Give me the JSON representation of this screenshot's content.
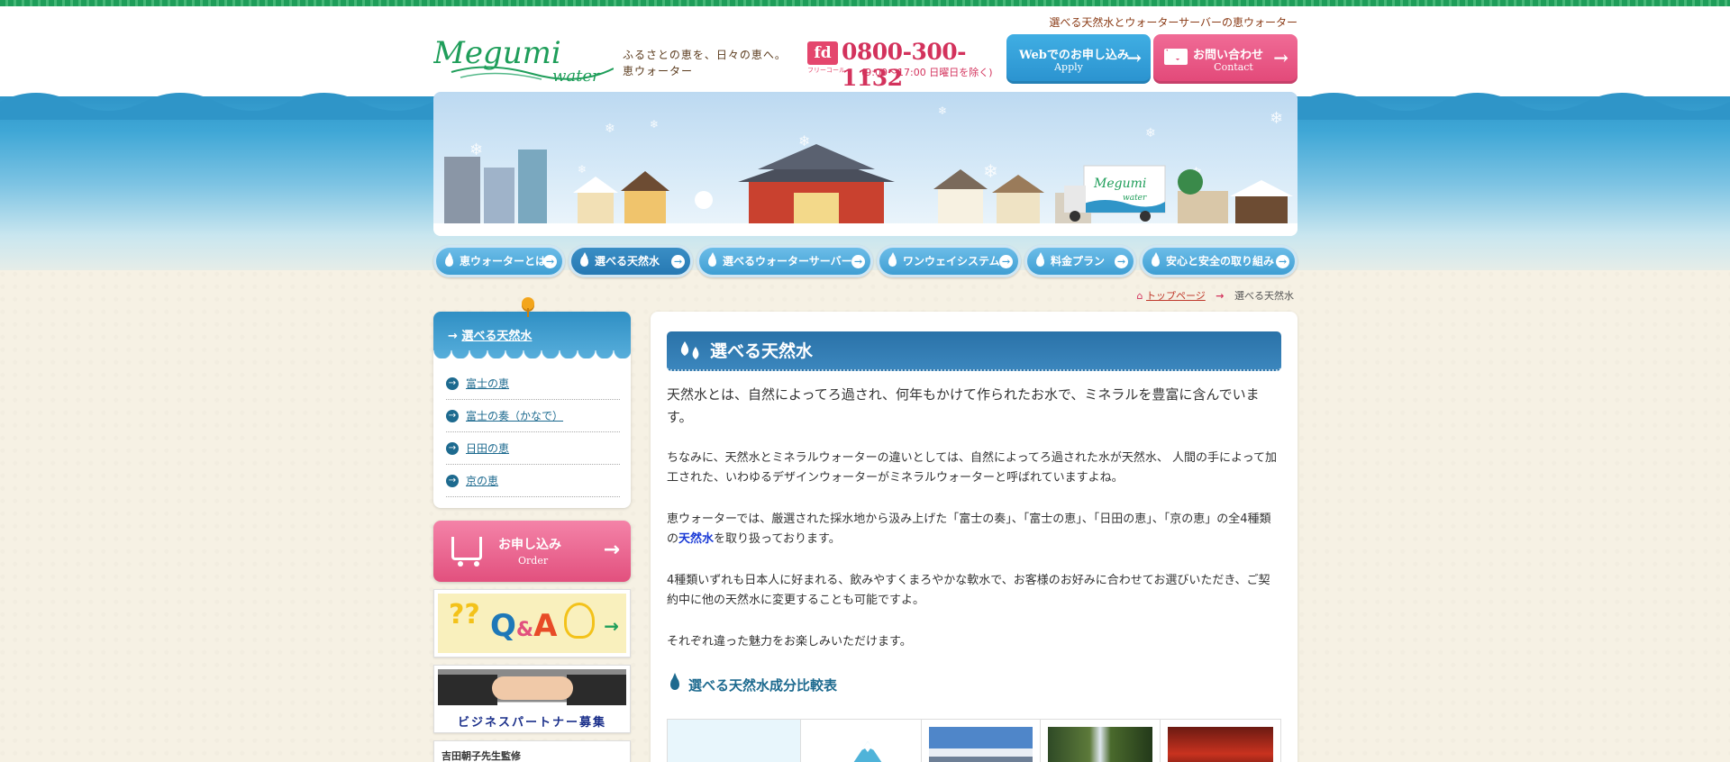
{
  "header": {
    "tagline": "選べる天然水とウォーターサーバーの恵ウォーター",
    "logo_main": "Megumi",
    "logo_sub": "water",
    "slogan_line1": "ふるさとの恵を、日々の恵へ。",
    "slogan_line2": "恵ウォーター",
    "freedial_mark": "fd",
    "freedial_label": "フリーコール",
    "phone": "0800-300-1132",
    "hours": "(9:00～17:00 日曜日を除く)",
    "apply_button": {
      "label": "Webでのお申し込み",
      "sub": "Apply"
    },
    "contact_button": {
      "label": "お問い合わせ",
      "sub": "Contact"
    }
  },
  "hero": {
    "truck_brand": "Megumi",
    "truck_sub": "water"
  },
  "nav": [
    {
      "label": "恵ウォーターとは",
      "active": false
    },
    {
      "label": "選べる天然水",
      "active": true
    },
    {
      "label": "選べるウォーターサーバー",
      "active": false
    },
    {
      "label": "ワンウェイシステム",
      "active": false
    },
    {
      "label": "料金プラン",
      "active": false
    },
    {
      "label": "安心と安全の取り組み",
      "active": false
    }
  ],
  "breadcrumb": {
    "home": "トップページ",
    "current": "選べる天然水"
  },
  "sidebar": {
    "title": "選べる天然水",
    "items": [
      {
        "label": "富士の恵"
      },
      {
        "label": "富士の奏（かなで）"
      },
      {
        "label": "日田の恵"
      },
      {
        "label": "京の恵"
      }
    ],
    "order": {
      "label": "お申し込み",
      "sub": "Order"
    },
    "qa_banner": {
      "q": "Q",
      "amp": "&",
      "a": "A",
      "question_marks": "??"
    },
    "business_banner": "ビジネスパートナー募集",
    "supervisor_banner": "吉田朝子先生監修"
  },
  "main": {
    "title": "選べる天然水",
    "lead": "天然水とは、自然によってろ過され、何年もかけて作られたお水で、ミネラルを豊富に含んでいます。",
    "p1": "ちなみに、天然水とミネラルウォーターの違いとしては、自然によってろ過された水が天然水、 人間の手によって加工された、いわゆるデザインウォーターがミネラルウォーターと呼ばれていますよね。",
    "p2_before": "恵ウォーターでは、厳選された採水地から汲み上げた「富士の奏」、「富士の恵」、「日田の恵」、「京の恵」の全4種類の",
    "p2_highlight": "天然水",
    "p2_after": "を取り扱っております。",
    "p3": "4種類いずれも日本人に好まれる、飲みやすくまろやかな軟水で、お客様のお好みに合わせてお選びいただき、ご契約中に他の天然水に変更することも可能ですよ。",
    "p4": "それぞれ違った魅力をお楽しみいただけます。",
    "table_heading": "選べる天然水成分比較表"
  },
  "colors": {
    "accent_blue": "#2a72a8",
    "accent_pink": "#e24878",
    "brand_green": "#1f9e5a"
  }
}
